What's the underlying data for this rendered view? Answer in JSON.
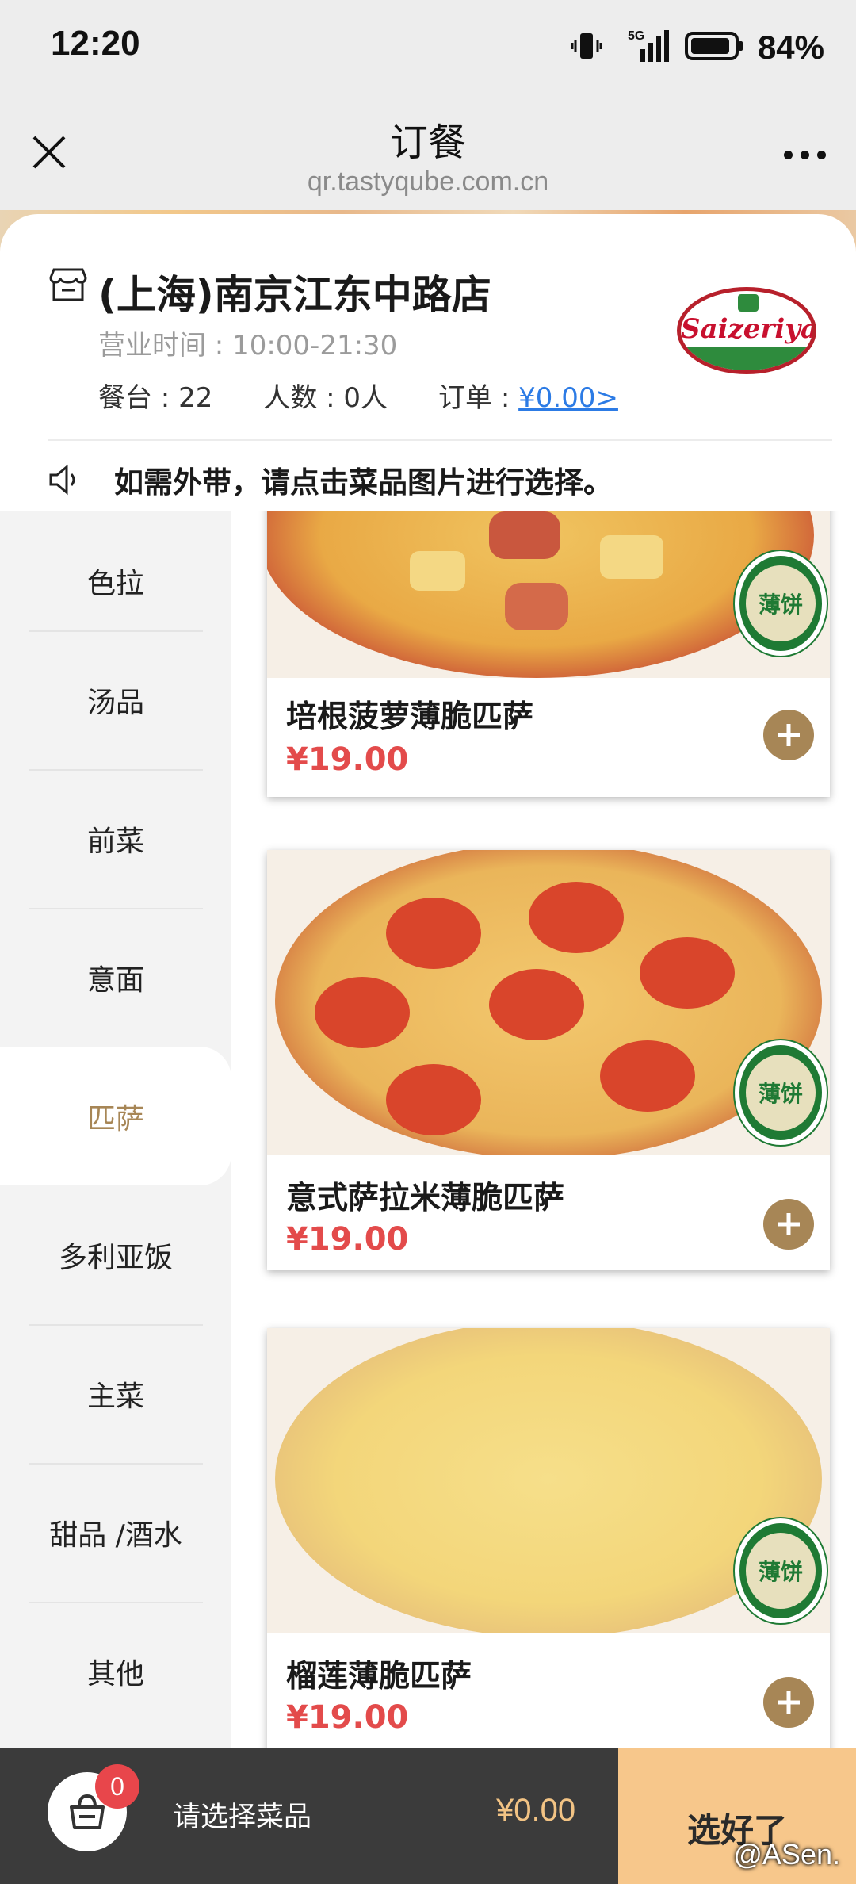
{
  "status_bar": {
    "time": "12:20",
    "network": "5G",
    "battery": "84%"
  },
  "title_bar": {
    "title": "订餐",
    "url": "qr.tastyqube.com.cn"
  },
  "store": {
    "name": "(上海)南京江东中路店",
    "hours": "营业时间 : 10:00-21:30",
    "table": "餐台 : 22",
    "people": "人数 : 0人",
    "order_label": "订单 : ",
    "order_amount": "¥0.00>",
    "logo_text": "Saizeriya",
    "notice": "如需外带，请点击菜品图片进行选择。"
  },
  "categories": [
    {
      "label": "色拉"
    },
    {
      "label": "汤品"
    },
    {
      "label": "前菜"
    },
    {
      "label": "意面"
    },
    {
      "label": "匹萨",
      "active": true
    },
    {
      "label": "多利亚饭"
    },
    {
      "label": "主菜"
    },
    {
      "label": "甜品 /酒水"
    },
    {
      "label": "其他"
    }
  ],
  "dishes": [
    {
      "name": "培根菠萝薄脆匹萨",
      "price": "¥19.00",
      "badge": "薄饼"
    },
    {
      "name": "意式萨拉米薄脆匹萨",
      "price": "¥19.00",
      "badge": "薄饼"
    },
    {
      "name": "榴莲薄脆匹萨",
      "price": "¥19.00",
      "badge": "薄饼"
    }
  ],
  "cart": {
    "count": "0",
    "hint": "请选择菜品",
    "total": "¥0.00",
    "submit": "选好了"
  },
  "watermark": "@ASen.",
  "colors": {
    "accent": "#a78656",
    "price": "#e34b4b",
    "link": "#2c7be5",
    "submit_bg": "#f7c78b"
  }
}
